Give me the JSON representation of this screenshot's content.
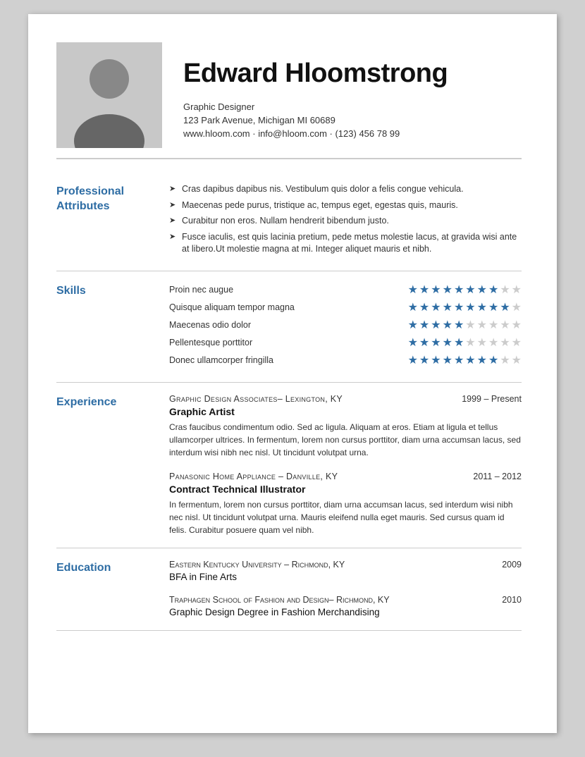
{
  "header": {
    "name": "Edward Hloomstrong",
    "title": "Graphic Designer",
    "address": "123 Park Avenue, Michigan MI 60689",
    "contact": "www.hloom.com · info@hloom.com · (123) 456 78 99"
  },
  "sections": {
    "professional": {
      "label": "Professional\nAttributes",
      "items": [
        "Cras dapibus dapibus nis. Vestibulum quis dolor a felis congue vehicula.",
        "Maecenas pede purus, tristique ac, tempus eget, egestas quis, mauris.",
        "Curabitur non eros. Nullam hendrerit bibendum justo.",
        "Fusce iaculis, est quis lacinia pretium, pede metus molestie lacus, at gravida wisi ante at libero.Ut molestie magna at mi. Integer aliquet mauris et nibh."
      ]
    },
    "skills": {
      "label": "Skills",
      "items": [
        {
          "name": "Proin nec augue",
          "filled": 8,
          "total": 10
        },
        {
          "name": "Quisque aliquam tempor magna",
          "filled": 9,
          "total": 10
        },
        {
          "name": "Maecenas odio dolor",
          "filled": 5,
          "total": 10
        },
        {
          "name": "Pellentesque porttitor",
          "filled": 5,
          "total": 10
        },
        {
          "name": "Donec ullamcorper fringilla",
          "filled": 8,
          "total": 10
        }
      ]
    },
    "experience": {
      "label": "Experience",
      "items": [
        {
          "company": "Graphic Design Associates– Lexington, KY",
          "dates": "1999 – Present",
          "title": "Graphic Artist",
          "description": "Cras faucibus condimentum odio. Sed ac ligula. Aliquam at eros. Etiam at ligula et tellus ullamcorper ultrices. In fermentum, lorem non cursus porttitor, diam urna accumsan lacus, sed interdum wisi nibh nec nisl. Ut tincidunt volutpat urna."
        },
        {
          "company": "Panasonic Home Appliance – Danville, KY",
          "dates": "2011 – 2012",
          "title": "Contract Technical Illustrator",
          "description": "In fermentum, lorem non cursus porttitor, diam urna accumsan lacus, sed interdum wisi nibh nec nisl. Ut tincidunt volutpat urna. Mauris eleifend nulla eget mauris. Sed cursus quam id felis. Curabitur posuere quam vel nibh."
        }
      ]
    },
    "education": {
      "label": "Education",
      "items": [
        {
          "school": "Eastern Kentucky University – Richmond, KY",
          "year": "2009",
          "degree": "BFA in Fine Arts"
        },
        {
          "school": "Traphagen School of Fashion and Design– Richmond, KY",
          "year": "2010",
          "degree": "Graphic Design Degree in Fashion Merchandising"
        }
      ]
    }
  }
}
